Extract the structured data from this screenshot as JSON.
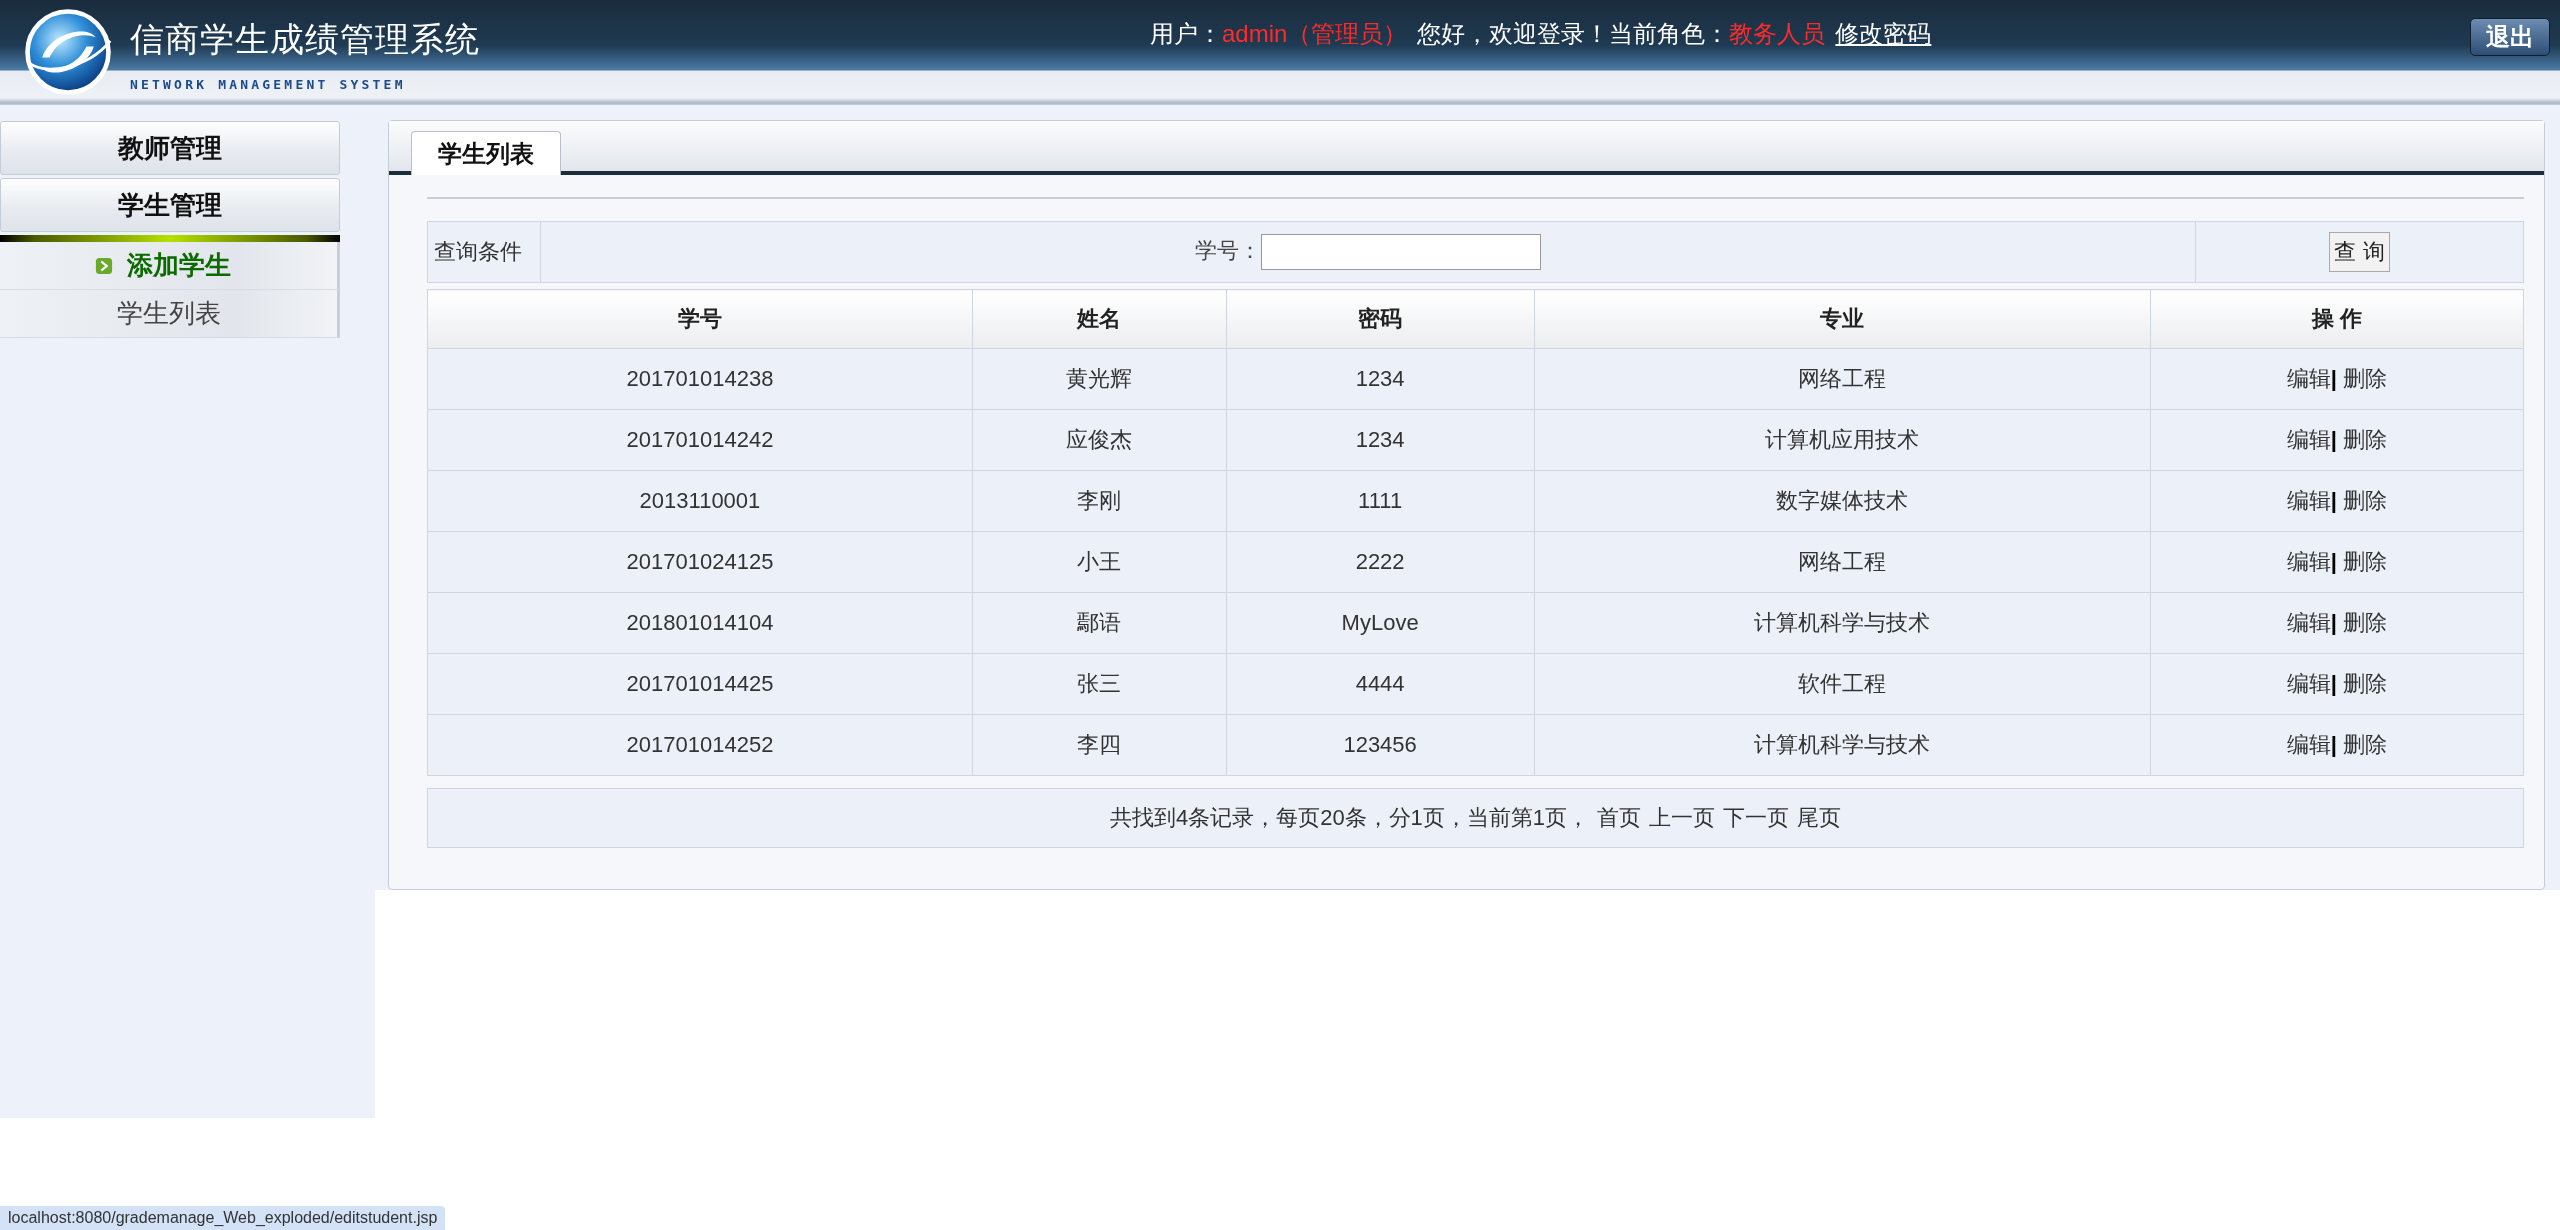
{
  "header": {
    "title": "信商学生成绩管理系统",
    "subtitle": "NETWORK MANAGEMENT SYSTEM",
    "user_label": "用户：",
    "user": "admin（管理员）",
    "greeting": "您好，欢迎登录！当前角色：",
    "role": "教务人员",
    "change_password_link": "修改密码",
    "logout_button": "退出"
  },
  "sidebar": {
    "items": [
      {
        "label": "教师管理"
      },
      {
        "label": "学生管理",
        "children": [
          {
            "label": "添加学生",
            "selected": true
          },
          {
            "label": "学生列表",
            "selected": false
          }
        ]
      }
    ]
  },
  "tabs": [
    {
      "label": "学生列表",
      "selected": true
    }
  ],
  "query": {
    "label": "查询条件",
    "field_label": "学号：",
    "button": "查 询"
  },
  "table": {
    "columns": [
      "学号",
      "姓名",
      "密码",
      "专业",
      "操 作"
    ],
    "action_separator": "|",
    "rows": [
      {
        "cells": [
          "201701014238",
          "黄光辉",
          "1234",
          "网络工程"
        ],
        "actions": [
          "编辑",
          "删除"
        ]
      },
      {
        "cells": [
          "201701014242",
          "应俊杰",
          "1234",
          "计算机应用技术"
        ],
        "actions": [
          "编辑",
          "删除"
        ]
      },
      {
        "cells": [
          "2013110001",
          "李刚",
          "1111",
          "数字媒体技术"
        ],
        "actions": [
          "编辑",
          "删除"
        ]
      },
      {
        "cells": [
          "201701024125",
          "小王",
          "2222",
          "网络工程"
        ],
        "actions": [
          "编辑",
          "删除"
        ]
      },
      {
        "cells": [
          "201801014104",
          "鄢语",
          "MyLove",
          "计算机科学与技术"
        ],
        "actions": [
          "编辑",
          "删除"
        ]
      },
      {
        "cells": [
          "201701014425",
          "张三",
          "4444",
          "软件工程"
        ],
        "actions": [
          "编辑",
          "删除"
        ]
      },
      {
        "cells": [
          "201701014252",
          "李四",
          "123456",
          "计算机科学与技术"
        ],
        "actions": [
          "编辑",
          "删除"
        ]
      }
    ]
  },
  "pager": {
    "summary": "共找到4条记录，每页20条，分1页，当前第1页，",
    "links": [
      "首页",
      "上一页",
      "下一页",
      "尾页"
    ]
  },
  "status_bar": "localhost:8080/grademanage_Web_exploded/editstudent.jsp"
}
